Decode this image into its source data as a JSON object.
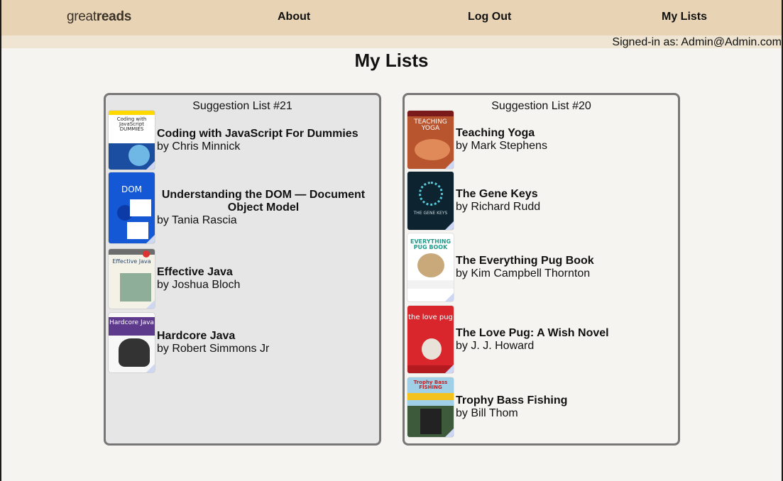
{
  "nav": {
    "logo_light": "great",
    "logo_bold": "reads",
    "about": "About",
    "logout": "Log Out",
    "mylists": "My Lists"
  },
  "signed_in": "Signed-in as: Admin@Admin.com",
  "page_title": "My Lists",
  "lists": [
    {
      "title": "Suggestion List #21",
      "books": [
        {
          "title": "Coding with JavaScript For Dummies",
          "author": "by Chris Minnick",
          "cover_text": "Coding with JavaScript DUMMIES"
        },
        {
          "title": "Understanding the DOM — Document Object Model",
          "author": "by Tania Rascia",
          "cover_text": "DOM"
        },
        {
          "title": "Effective Java",
          "author": "by Joshua Bloch",
          "cover_text": "Effective Java"
        },
        {
          "title": "Hardcore Java",
          "author": "by Robert Simmons Jr",
          "cover_text": "Hardcore Java"
        }
      ]
    },
    {
      "title": "Suggestion List #20",
      "books": [
        {
          "title": "Teaching Yoga",
          "author": "by Mark Stephens",
          "cover_text": "TEACHING YOGA"
        },
        {
          "title": "The Gene Keys",
          "author": "by Richard Rudd",
          "cover_text": "THE GENE KEYS"
        },
        {
          "title": "The Everything Pug Book",
          "author": "by Kim Campbell Thornton",
          "cover_text": "EVERYTHING PUG BOOK"
        },
        {
          "title": "The Love Pug: A Wish Novel",
          "author": "by J. J. Howard",
          "cover_text": "the love pug"
        },
        {
          "title": "Trophy Bass Fishing",
          "author": "by Bill Thom",
          "cover_text": "Trophy Bass FISHING"
        }
      ]
    }
  ]
}
